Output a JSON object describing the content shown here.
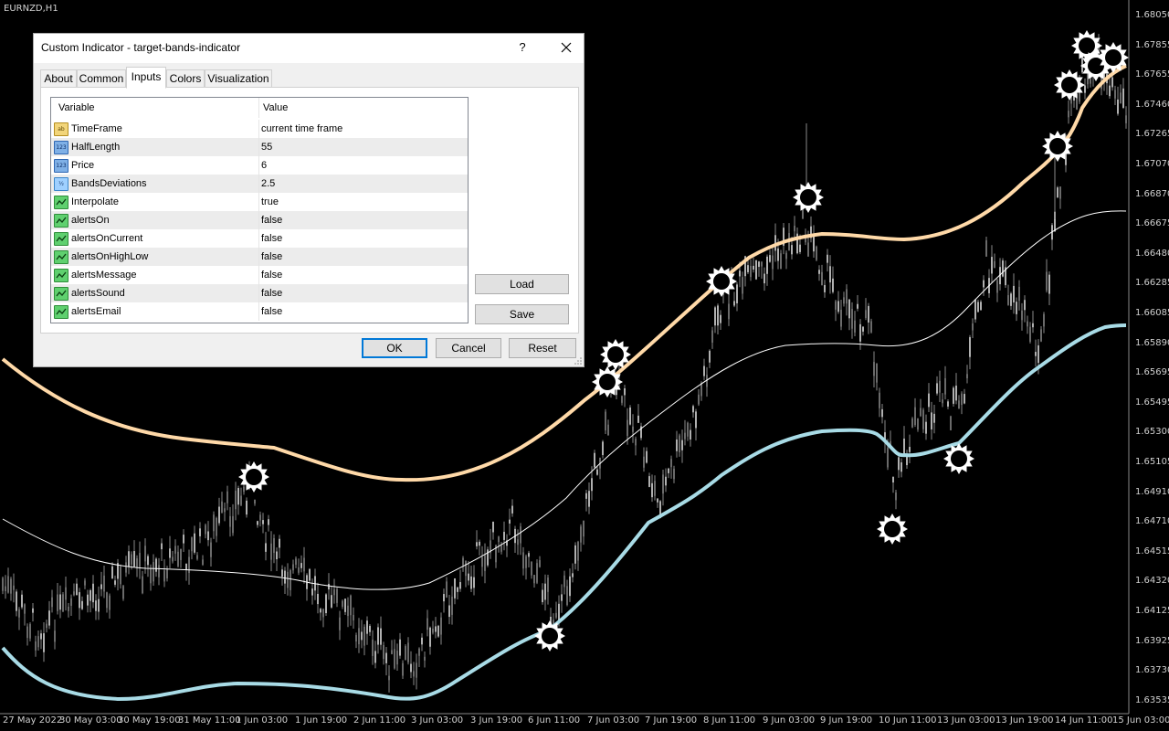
{
  "chart": {
    "symbol": "EURNZD,H1",
    "price_labels": [
      "1.68050",
      "1.67855",
      "1.67655",
      "1.67460",
      "1.67265",
      "1.67070",
      "1.66870",
      "1.66675",
      "1.66480",
      "1.66285",
      "1.66085",
      "1.65890",
      "1.65695",
      "1.65495",
      "1.65300",
      "1.65105",
      "1.64910",
      "1.64710",
      "1.64515",
      "1.64320",
      "1.64125",
      "1.63925",
      "1.63730",
      "1.63535"
    ],
    "time_labels": [
      "27 May 2022",
      "30 May 03:00",
      "30 May 19:00",
      "31 May 11:00",
      "1 Jun 03:00",
      "1 Jun 19:00",
      "2 Jun 11:00",
      "3 Jun 03:00",
      "3 Jun 19:00",
      "6 Jun 11:00",
      "7 Jun 03:00",
      "7 Jun 19:00",
      "8 Jun 11:00",
      "9 Jun 03:00",
      "9 Jun 19:00",
      "10 Jun 11:00",
      "13 Jun 03:00",
      "13 Jun 19:00",
      "14 Jun 11:00",
      "15 Jun 03:00"
    ],
    "colors": {
      "upper_band": "#ffd9a8",
      "lower_band": "#a8dbe6",
      "middle_line": "#ffffff",
      "candles": "#8a8a8a",
      "background": "#000000"
    }
  },
  "dialog": {
    "title": "Custom Indicator - target-bands-indicator",
    "help_label": "?",
    "tabs": [
      "About",
      "Common",
      "Inputs",
      "Colors",
      "Visualization"
    ],
    "active_tab": "Inputs",
    "columns": {
      "variable": "Variable",
      "value": "Value"
    },
    "params": [
      {
        "icon": "text-icon",
        "glyph": "ab",
        "name": "TimeFrame",
        "value": "current time frame"
      },
      {
        "icon": "integer-icon",
        "glyph": "123",
        "name": "HalfLength",
        "value": "55"
      },
      {
        "icon": "integer-icon",
        "glyph": "123",
        "name": "Price",
        "value": "6"
      },
      {
        "icon": "double-icon",
        "glyph": "½",
        "name": "BandsDeviations",
        "value": "2.5"
      },
      {
        "icon": "bool-icon",
        "glyph": "",
        "name": "Interpolate",
        "value": "true"
      },
      {
        "icon": "bool-icon",
        "glyph": "",
        "name": "alertsOn",
        "value": "false"
      },
      {
        "icon": "bool-icon",
        "glyph": "",
        "name": "alertsOnCurrent",
        "value": "false"
      },
      {
        "icon": "bool-icon",
        "glyph": "",
        "name": "alertsOnHighLow",
        "value": "false"
      },
      {
        "icon": "bool-icon",
        "glyph": "",
        "name": "alertsMessage",
        "value": "false"
      },
      {
        "icon": "bool-icon",
        "glyph": "",
        "name": "alertsSound",
        "value": "false"
      },
      {
        "icon": "bool-icon",
        "glyph": "",
        "name": "alertsEmail",
        "value": "false"
      }
    ],
    "load_label": "Load",
    "save_label": "Save",
    "ok_label": "OK",
    "cancel_label": "Cancel",
    "reset_label": "Reset"
  }
}
